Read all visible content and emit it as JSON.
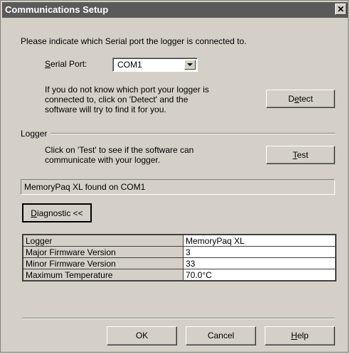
{
  "window": {
    "title": "Communications Setup",
    "close_glyph": "✕"
  },
  "prompt": "Please indicate which Serial port the logger is connected to.",
  "serial_port": {
    "label_prefix": "",
    "label_accel": "S",
    "label_rest": "erial Port:",
    "value": "COM1"
  },
  "detect": {
    "help_lines": [
      "If you do not know which port your logger is",
      "connected to, click on 'Detect' and the",
      "software will try to find it for you."
    ],
    "button_pre": "D",
    "button_accel": "e",
    "button_post": "tect"
  },
  "logger_group": {
    "label": "Logger",
    "help_lines": [
      "Click on 'Test' to see if the software can",
      "communicate with your logger."
    ],
    "test_accel": "T",
    "test_post": "est"
  },
  "status": "MemoryPaq XL found on COM1",
  "diagnostic": {
    "accel": "D",
    "rest": "iagnostic <<"
  },
  "diag_rows": [
    {
      "key": "Logger",
      "value": "MemoryPaq XL"
    },
    {
      "key": "Major Firmware Version",
      "value": "3"
    },
    {
      "key": "Minor Firmware Version",
      "value": "33"
    },
    {
      "key": "Maximum Temperature",
      "value": "70.0°C"
    }
  ],
  "footer": {
    "ok": "OK",
    "cancel": "Cancel",
    "help_accel": "H",
    "help_rest": "elp"
  }
}
